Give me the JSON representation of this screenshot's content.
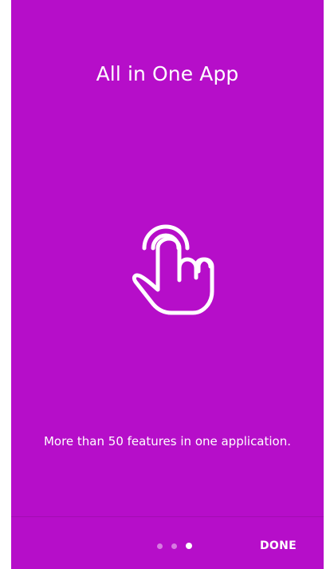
{
  "onboarding": {
    "title": "All in One App",
    "icon": "touch-hand-icon",
    "description": "More than 50 features in one application.",
    "pagination": {
      "current": 3,
      "total": 3
    },
    "done_label": "DONE"
  },
  "colors": {
    "background": "#b60ec9",
    "foreground": "#ffffff",
    "divider": "#a20cb2"
  }
}
